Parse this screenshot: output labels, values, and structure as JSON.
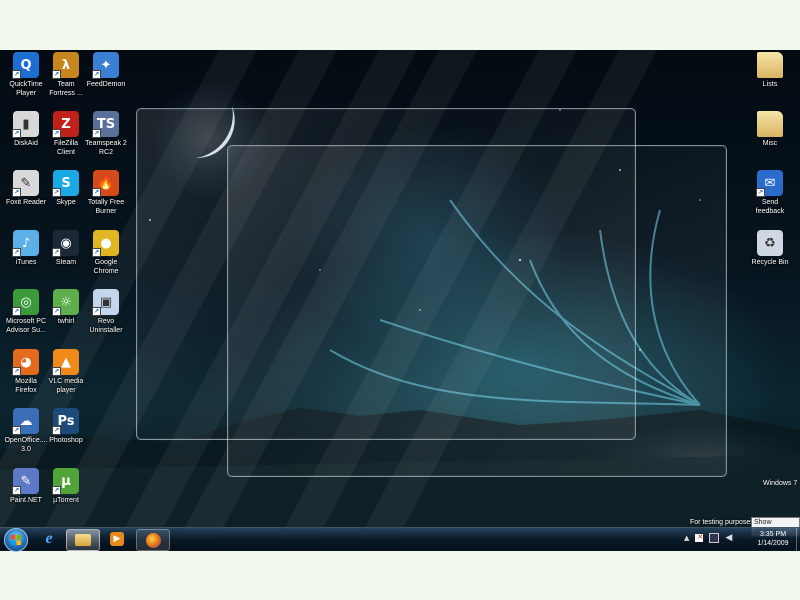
{
  "desktop": {
    "icons_left": [
      {
        "label": "QuickTime\nPlayer",
        "icon": "quicktime-icon",
        "color": "#1c6fd1"
      },
      {
        "label": "Team\nFortress ...",
        "icon": "team-fortress-icon",
        "color": "#c8861e"
      },
      {
        "label": "FeedDemon",
        "icon": "feeddemon-icon",
        "color": "#3b7fd4"
      },
      {
        "label": "DiskAid",
        "icon": "diskaid-icon",
        "color": "#d8d8d8"
      },
      {
        "label": "FileZilla\nClient",
        "icon": "filezilla-icon",
        "color": "#c0221b"
      },
      {
        "label": "Teamspeak 2\nRC2",
        "icon": "teamspeak-icon",
        "color": "#5a6f9a"
      },
      {
        "label": "Foxit Reader",
        "icon": "foxit-reader-icon",
        "color": "#d9d9d9"
      },
      {
        "label": "Skype",
        "icon": "skype-icon",
        "color": "#19a9e5"
      },
      {
        "label": "Totally Free\nBurner",
        "icon": "burner-icon",
        "color": "#d54a1a"
      },
      {
        "label": "iTunes",
        "icon": "itunes-icon",
        "color": "#5bb0e8"
      },
      {
        "label": "Steam",
        "icon": "steam-icon",
        "color": "#1b2838"
      },
      {
        "label": "Google\nChrome",
        "icon": "chrome-icon",
        "color": "#e0b623"
      },
      {
        "label": "Microsoft PC\nAdvisor Su...",
        "icon": "pc-advisor-icon",
        "color": "#3c9a3c"
      },
      {
        "label": "twhirl",
        "icon": "twhirl-icon",
        "color": "#5fae4e"
      },
      {
        "label": "Revo\nUninstaller",
        "icon": "revo-icon",
        "color": "#c4d6ee"
      },
      {
        "label": "Mozilla\nFirefox",
        "icon": "firefox-icon",
        "color": "#e46b1e"
      },
      {
        "label": "VLC media\nplayer",
        "icon": "vlc-icon",
        "color": "#f08a1a"
      },
      {
        "label": "OpenOffice....\n3.0",
        "icon": "openoffice-icon",
        "color": "#3a6fb7"
      },
      {
        "label": "Photoshop",
        "icon": "photoshop-icon",
        "color": "#1c4b7b"
      },
      {
        "label": "Paint.NET",
        "icon": "paintnet-icon",
        "color": "#5d78c4"
      },
      {
        "label": "µTorrent",
        "icon": "utorrent-icon",
        "color": "#4fa43a"
      }
    ],
    "icons_right": [
      {
        "label": "Lists",
        "icon": "folder-lists-icon",
        "color": "#e4c98a"
      },
      {
        "label": "Misc",
        "icon": "folder-misc-icon",
        "color": "#e4c98a"
      },
      {
        "label": "Send\nfeedback",
        "icon": "send-feedback-icon",
        "color": "#2a6bcc"
      },
      {
        "label": "Recycle Bin",
        "icon": "recycle-bin-icon",
        "color": "#cfd8e2"
      }
    ],
    "watermark": {
      "line1": "Windows 7",
      "line2": "For testing purposes",
      "show_desktop_tooltip": "Show desktop"
    }
  },
  "taskbar": {
    "pinned": [
      "ie-icon",
      "explorer-icon",
      "media-player-icon",
      "firefox-icon"
    ],
    "tray_icons": [
      "show-hidden-icons-icon",
      "action-center-icon",
      "network-icon",
      "volume-icon"
    ],
    "clock": {
      "time": "3:35 PM",
      "date": "1/14/2009"
    }
  }
}
